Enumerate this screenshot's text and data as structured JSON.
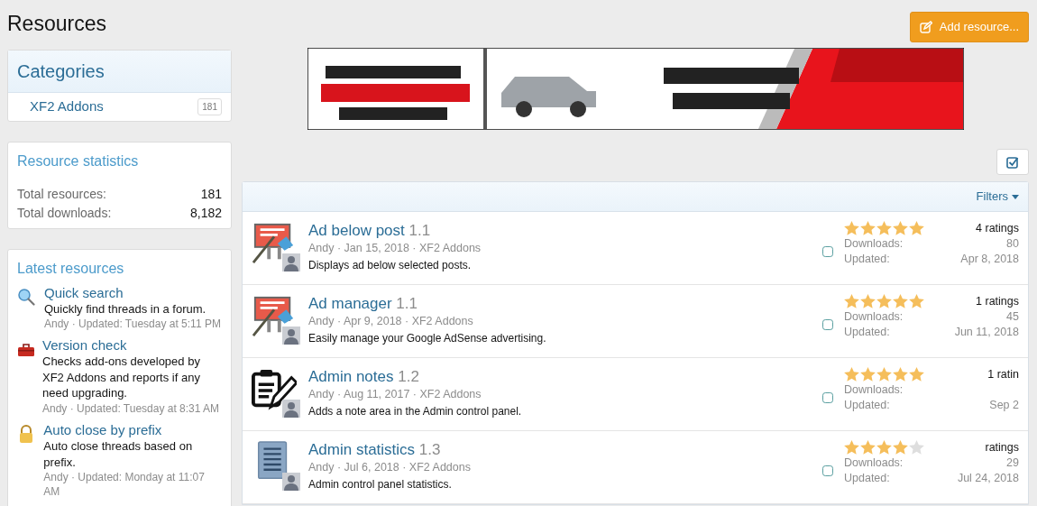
{
  "page_title": "Resources",
  "add_button": {
    "label": "Add resource..."
  },
  "categories": {
    "title": "Categories",
    "items": [
      {
        "label": "XF2 Addons",
        "count": "181"
      }
    ]
  },
  "statistics": {
    "title": "Resource statistics",
    "rows": [
      {
        "label": "Total resources:",
        "value": "181"
      },
      {
        "label": "Total downloads:",
        "value": "8,182"
      }
    ]
  },
  "latest": {
    "title": "Latest resources",
    "items": [
      {
        "title": "Quick search",
        "description": "Quickly find threads in a forum.",
        "meta": "Andy · Updated: Tuesday at 5:11 PM"
      },
      {
        "title": "Version check",
        "description": "Checks add-ons developed by XF2 Addons and reports if any need upgrading.",
        "meta": "Andy · Updated: Tuesday at 8:31 AM"
      },
      {
        "title": "Auto close by prefix",
        "description": "Auto close threads based on prefix.",
        "meta": "Andy · Updated: Monday at 11:07 AM"
      }
    ]
  },
  "filters": {
    "label": "Filters"
  },
  "resources": [
    {
      "title": "Ad below post",
      "version": "1.1",
      "meta": "Andy · Jan 15, 2018 · XF2 Addons",
      "description": "Displays ad below selected posts.",
      "selected": false,
      "stars": 5,
      "ratings": "4 ratings",
      "downloads_label": "Downloads:",
      "downloads": "80",
      "updated_label": "Updated:",
      "updated": "Apr 8, 2018"
    },
    {
      "title": "Ad manager",
      "version": "1.1",
      "meta": "Andy · Apr 9, 2018 · XF2 Addons",
      "description": "Easily manage your Google AdSense advertising.",
      "selected": false,
      "stars": 5,
      "ratings": "1 ratings",
      "downloads_label": "Downloads:",
      "downloads": "45",
      "updated_label": "Updated:",
      "updated": "Jun 11, 2018"
    },
    {
      "title": "Admin notes",
      "version": "1.2",
      "meta": "Andy · Aug 11, 2017 · XF2 Addons",
      "description": "Adds a note area in the Admin control panel.",
      "selected": false,
      "stars": 5,
      "ratings": "1 ratin",
      "downloads_label": "Downloads:",
      "updated_label": "Updated:",
      "updated": "Sep 2"
    },
    {
      "title": "Admin statistics",
      "version": "1.3",
      "meta": "Andy · Jul 6, 2018 · XF2 Addons",
      "description": "Admin control panel statistics.",
      "selected": false,
      "stars": 4,
      "ratings": "ratings",
      "downloads_label": "Downloads:",
      "downloads": "29",
      "updated_label": "Updated:",
      "updated": "Jul 24, 2018"
    }
  ]
}
